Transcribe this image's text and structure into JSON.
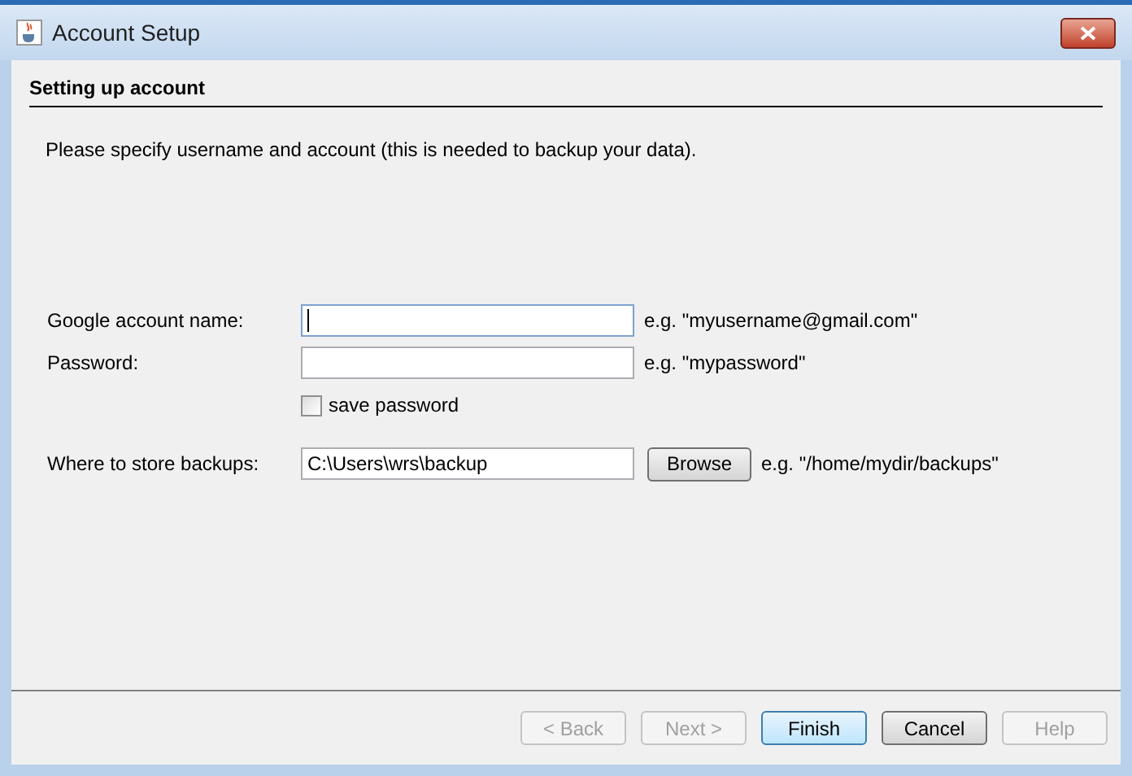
{
  "window": {
    "title": "Account Setup"
  },
  "header": {
    "title": "Setting up account"
  },
  "intro": "Please specify username and account (this is needed to backup your data).",
  "fields": [
    {
      "label": "Google account name:",
      "focused": true,
      "example": "e.g. \"myusername@gmail.com\""
    },
    {
      "label": "Password:",
      "focused": false,
      "example": "e.g. \"mypassword\""
    }
  ],
  "save_password": {
    "label": "save password",
    "checked": false
  },
  "backup": {
    "label": "Where to store backups:",
    "value": "C:\\Users\\wrs\\backup",
    "button": "Browse",
    "example": "e.g. \"/home/mydir/backups\""
  },
  "buttons": [
    {
      "label": "< Back",
      "disabled": true,
      "default": false
    },
    {
      "label": "Next >",
      "disabled": true,
      "default": false
    },
    {
      "label": "Finish",
      "disabled": false,
      "default": true
    },
    {
      "label": "Cancel",
      "disabled": false,
      "default": false
    },
    {
      "label": "Help",
      "disabled": true,
      "default": false
    }
  ]
}
